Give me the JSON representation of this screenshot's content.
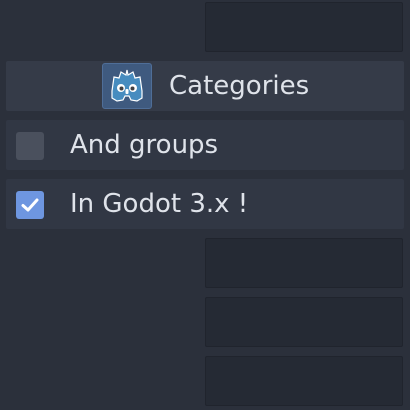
{
  "header": {
    "label": "Categories",
    "icon": "godot-logo-icon",
    "icon_bg_color": "#3f5a7f"
  },
  "options": [
    {
      "label": "And groups",
      "checked": false
    },
    {
      "label": "In Godot 3.x !",
      "checked": true
    }
  ],
  "colors": {
    "background": "#2b303b",
    "checkbox_checked": "#6e96e0",
    "checkbox_unchecked": "#4a505d",
    "text": "#dfe3ea"
  }
}
